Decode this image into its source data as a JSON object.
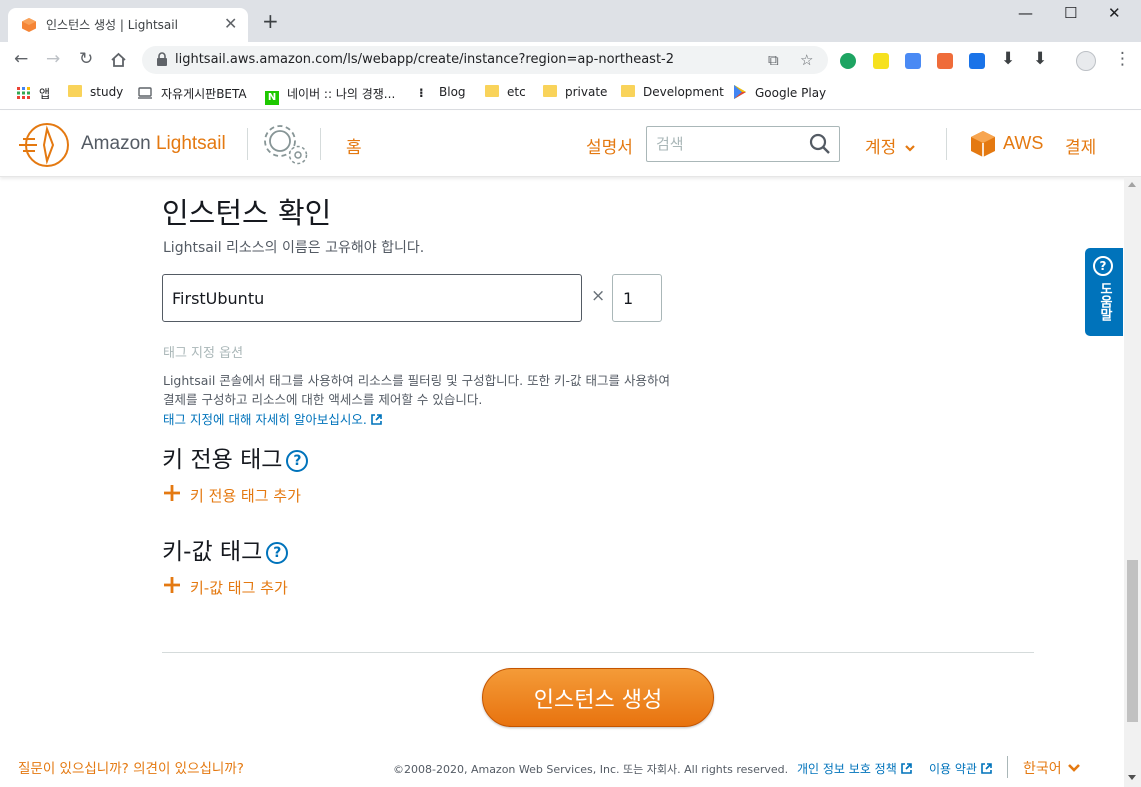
{
  "browser": {
    "tab_title": "인스턴스 생성 | Lightsail",
    "url": "lightsail.aws.amazon.com/ls/webapp/create/instance?region=ap-northeast-2",
    "bookmarks": [
      {
        "label": "앱",
        "icon": "apps-grid-icon"
      },
      {
        "label": "study",
        "icon": "folder-icon"
      },
      {
        "label": "자유게시판BETA",
        "icon": "board-icon"
      },
      {
        "label": "네이버 :: 나의 경쟁...",
        "icon": "naver-icon"
      },
      {
        "label": "Blog",
        "icon": "blog-icon"
      },
      {
        "label": "etc",
        "icon": "folder-icon"
      },
      {
        "label": "private",
        "icon": "folder-icon"
      },
      {
        "label": "Development",
        "icon": "folder-icon"
      },
      {
        "label": "Google Play",
        "icon": "google-play-icon"
      }
    ]
  },
  "header": {
    "brand_prefix": "Amazon ",
    "brand_name": "Lightsail",
    "home": "홈",
    "docs": "설명서",
    "search_placeholder": "검색",
    "account": "계정",
    "aws": "AWS",
    "billing": "결제"
  },
  "instance": {
    "title": "인스턴스 확인",
    "description": "Lightsail 리소스의 이름은 고유해야 합니다.",
    "name_value": "FirstUbuntu",
    "multiply": "×",
    "count_value": "1"
  },
  "tags": {
    "heading": "태그 지정 옵션",
    "description_line1": "Lightsail 콘솔에서 태그를 사용하여 리소스를 필터링 및 구성합니다. 또한 키-값 태그를 사용하여",
    "description_line2": "결제를 구성하고 리소스에 대한 액세스를 제어할 수 있습니다.",
    "learn_more": "태그 지정에 대해 자세히 알아보십시오.",
    "key_only_title": "키 전용 태그",
    "key_only_add": "키 전용 태그 추가",
    "key_value_title": "키-값 태그",
    "key_value_add": "키-값 태그 추가",
    "help_symbol": "?"
  },
  "create_button": "인스턴스 생성",
  "footer": {
    "question": "질문이 있으십니까? 의견이 있으십니까?",
    "copyright": "©2008-2020, Amazon Web Services, Inc. 또는 자회사. All rights reserved.",
    "privacy": "개인 정보 보호 정책",
    "terms": "이용 약관",
    "language": "한국어"
  },
  "help_tab": {
    "symbol": "?",
    "label": "도움말"
  },
  "colors": {
    "accent": "#e47911",
    "link": "#0073bb",
    "text": "#16191f"
  }
}
